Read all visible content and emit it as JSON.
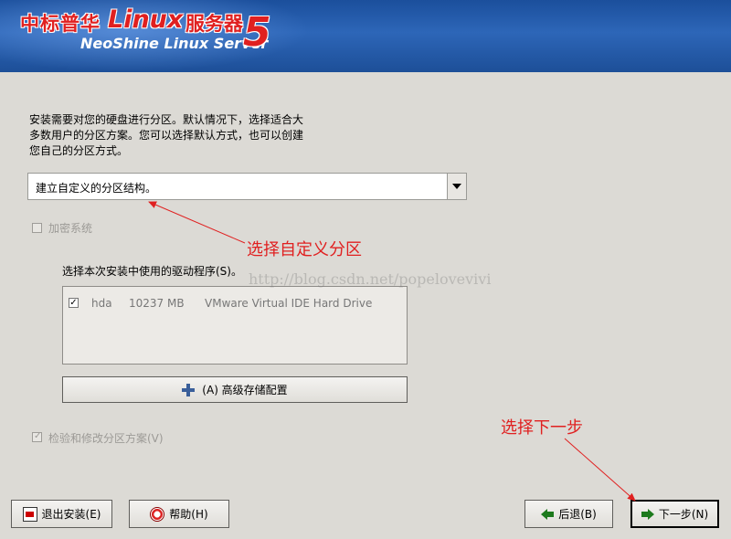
{
  "banner": {
    "brand_cn": "中标普华",
    "brand_linux": "Linux",
    "brand_server_cn": "服务器",
    "brand_en": "NeoShine Linux Server",
    "version": "5"
  },
  "intro_text": "安装需要对您的硬盘进行分区。默认情况下，选择适合大多数用户的分区方案。您可以选择默认方式，也可以创建您自己的分区方式。",
  "partition_combo": {
    "selected": "建立自定义的分区结构。"
  },
  "encrypt": {
    "label": "加密系统",
    "checked": false,
    "enabled": false
  },
  "drivers": {
    "label": "选择本次安装中使用的驱动程序(S)。",
    "rows": [
      {
        "checked": true,
        "name": "hda",
        "size": "10237 MB",
        "model": "VMware Virtual IDE Hard Drive"
      }
    ]
  },
  "advanced_button": {
    "label": "(A) 高级存储配置"
  },
  "verify": {
    "label": "检验和修改分区方案(V)",
    "checked": true,
    "enabled": false
  },
  "buttons": {
    "exit": "退出安装(E)",
    "help": "帮助(H)",
    "back": "后退(B)",
    "next": "下一步(N)"
  },
  "annotations": {
    "custom_partition": "选择自定义分区",
    "next_step": "选择下一步",
    "color": "#e02020"
  },
  "watermark": "http://blog.csdn.net/popelovevivi"
}
